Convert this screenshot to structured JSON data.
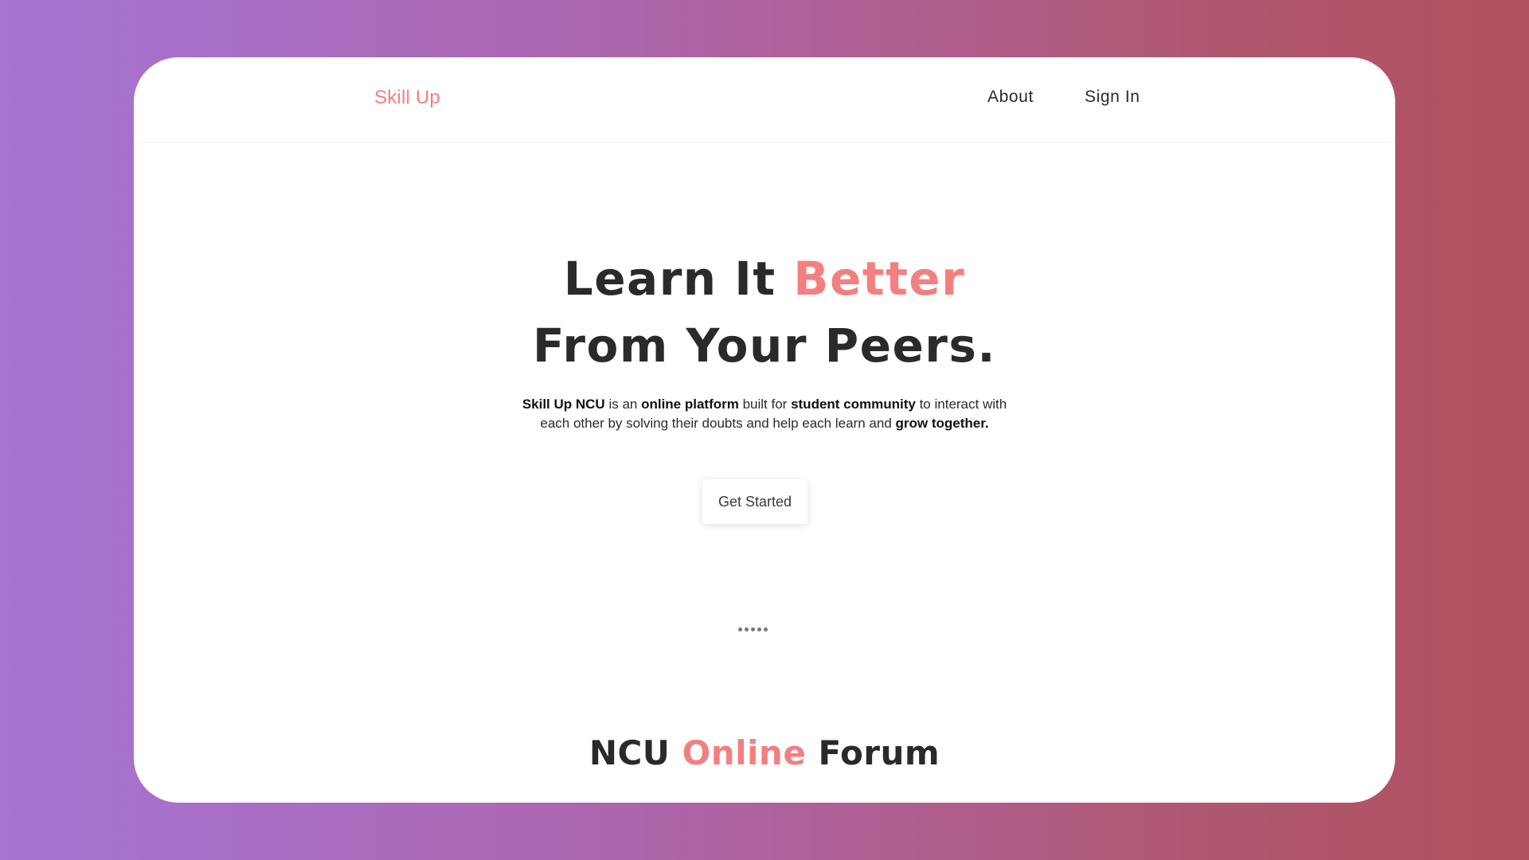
{
  "nav": {
    "brand": "Skill Up",
    "about": "About",
    "sign_in": "Sign In"
  },
  "hero": {
    "title_line1_part1": "Learn It ",
    "title_line1_accent": "Better",
    "title_line2": "From Your Peers.",
    "description": {
      "b1": "Skill Up NCU",
      "t1": " is an ",
      "b2": "online platform",
      "t2": " built for ",
      "b3": "student community",
      "t3": " to interact with each other by solving their doubts and help each learn and ",
      "b4": "grow together."
    },
    "cta_label": "Get Started"
  },
  "loader": {
    "dots": 5
  },
  "forum": {
    "title_part1": "NCU ",
    "title_accent": "Online",
    "title_part2": " Forum"
  },
  "colors": {
    "accent": "#f47f80",
    "text": "#2a2a2a",
    "background_gradient_start": "#a574d4",
    "background_gradient_end": "#b2505f",
    "card": "#ffffff"
  }
}
